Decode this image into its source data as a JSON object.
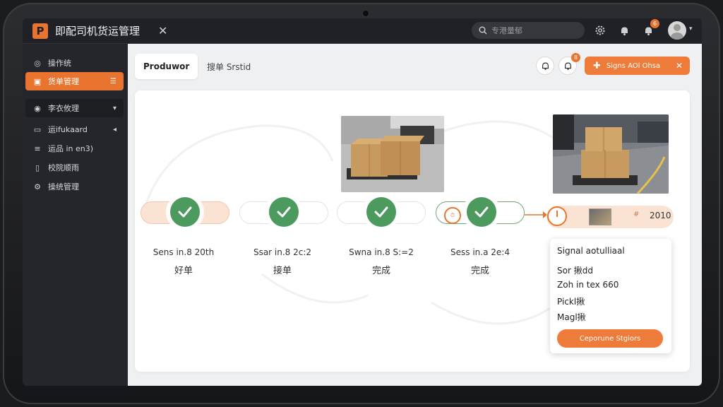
{
  "app": {
    "logo_text": "P",
    "title": "即配司机货运管理",
    "close_label": "✕"
  },
  "search": {
    "placeholder": "专港量郁"
  },
  "topbar": {
    "notification_badge": "6"
  },
  "sidebar": {
    "items": [
      {
        "label": "操作统",
        "icon": "home-icon"
      },
      {
        "label": "货单管理",
        "icon": "clipboard-icon",
        "active": true
      },
      {
        "label": "李衣攸理",
        "icon": "target-icon",
        "arrow": "▾"
      },
      {
        "label": "运ifukaard",
        "icon": "folder-icon",
        "arrow": "◂"
      },
      {
        "label": "运品 in en3)",
        "icon": "list-icon"
      },
      {
        "label": "校院顺雨",
        "icon": "document-icon"
      },
      {
        "label": "操统管理",
        "icon": "gear-icon"
      }
    ]
  },
  "main": {
    "tab_active": "Produwor",
    "tab_second": "搜单 Srstid",
    "action_button": "Signs AOl Ohsa",
    "action_badge": "8"
  },
  "steps": [
    {
      "date": "Sens in.8 20th",
      "status": "好单"
    },
    {
      "date": "Ssar in.8 2c:2",
      "status": "接单"
    },
    {
      "date": "Swna in.8 S:=2",
      "status": "完成"
    },
    {
      "date": "Sess in.a 2e:4",
      "status": "完成"
    }
  ],
  "final": {
    "mark": "#",
    "year": "2010"
  },
  "popup": {
    "title": "Signal aotulliaal",
    "row1": "Sor 揪dd",
    "row2": "Zoh in tex 660",
    "row3": "Pickl揪",
    "row4": "Magl揪",
    "button": "Ceporune Stgiors"
  },
  "colors": {
    "accent": "#e8742f",
    "success": "#4c9a5d",
    "sidebar_bg": "#24262b",
    "main_bg": "#eef0f2"
  }
}
